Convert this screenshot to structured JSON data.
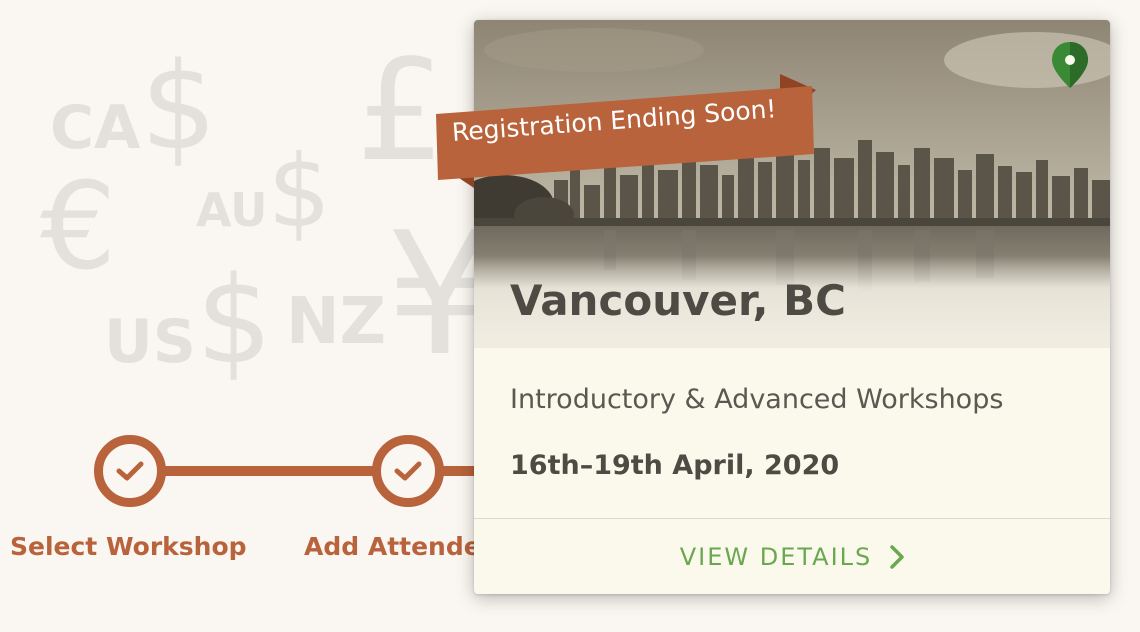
{
  "background_symbols": {
    "ca": "CA",
    "dollar": "$",
    "pound": "£",
    "euro": "€",
    "au": "AU",
    "us": "US",
    "nz": "NZ",
    "yen": "¥"
  },
  "steps": [
    {
      "label": "Select Workshop",
      "state": "complete",
      "icon": "check-icon"
    },
    {
      "label": "Add Attende",
      "state": "complete",
      "icon": "check-icon"
    }
  ],
  "card": {
    "ribbon_text": "Registration Ending Soon!",
    "location": "Vancouver, BC",
    "subtitle": "Introductory & Advanced Workshops",
    "date": "16th–19th April, 2020",
    "cta_label": "VIEW DETAILS",
    "cta_icon": "chevron-right-icon",
    "pin_icon": "map-pin-icon"
  },
  "colors": {
    "accent": "#b8633b",
    "cta": "#6aa84f",
    "pin": "#3a8a35",
    "background": "#faf6f1",
    "card": "#fbf8ec"
  }
}
